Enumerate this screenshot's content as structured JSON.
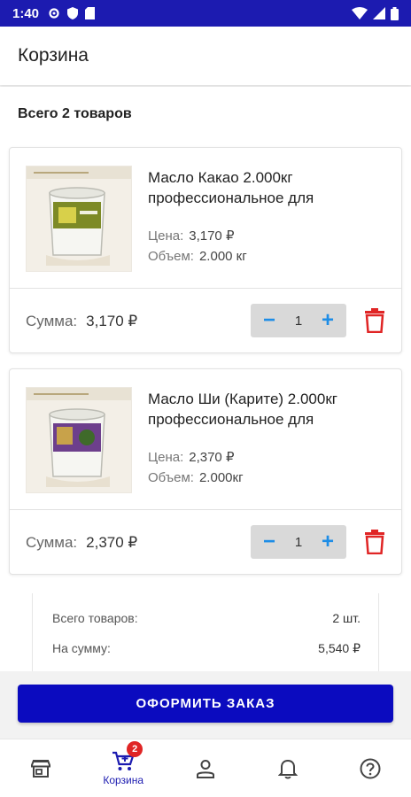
{
  "status_bar": {
    "time": "1:40"
  },
  "header": {
    "title": "Корзина"
  },
  "cart": {
    "total_count_text": "Всего 2 товаров",
    "items": [
      {
        "name": "Масло Какао 2.000кг профессиональное для",
        "price_label": "Цена:",
        "price": "3,170 ₽",
        "volume_label": "Объем:",
        "volume": "2.000 кг",
        "sum_label": "Сумма:",
        "sum": "3,170 ₽",
        "quantity": "1"
      },
      {
        "name": "Масло Ши (Карите) 2.000кг профессиональное для",
        "price_label": "Цена:",
        "price": "2,370 ₽",
        "volume_label": "Объем:",
        "volume": "2.000кг",
        "sum_label": "Сумма:",
        "sum": "2,370 ₽",
        "quantity": "1"
      }
    ]
  },
  "summary": {
    "items_label": "Всего товаров:",
    "items_value": "2 шт.",
    "sum_label": "На сумму:",
    "sum_value": "5,540 ₽"
  },
  "checkout_button": "ОФОРМИТЬ ЗАКАЗ",
  "bottom_nav": {
    "items": [
      {
        "icon": "store-icon",
        "label": ""
      },
      {
        "icon": "cart-icon",
        "label": "Корзина",
        "badge": "2",
        "active": true
      },
      {
        "icon": "person-icon",
        "label": ""
      },
      {
        "icon": "bell-icon",
        "label": ""
      },
      {
        "icon": "help-icon",
        "label": ""
      }
    ]
  },
  "colors": {
    "primary": "#1c1bb0",
    "button": "#0b0bbf",
    "accent_blue": "#1e8de6",
    "delete_red": "#e02525",
    "badge_red": "#e02525"
  }
}
